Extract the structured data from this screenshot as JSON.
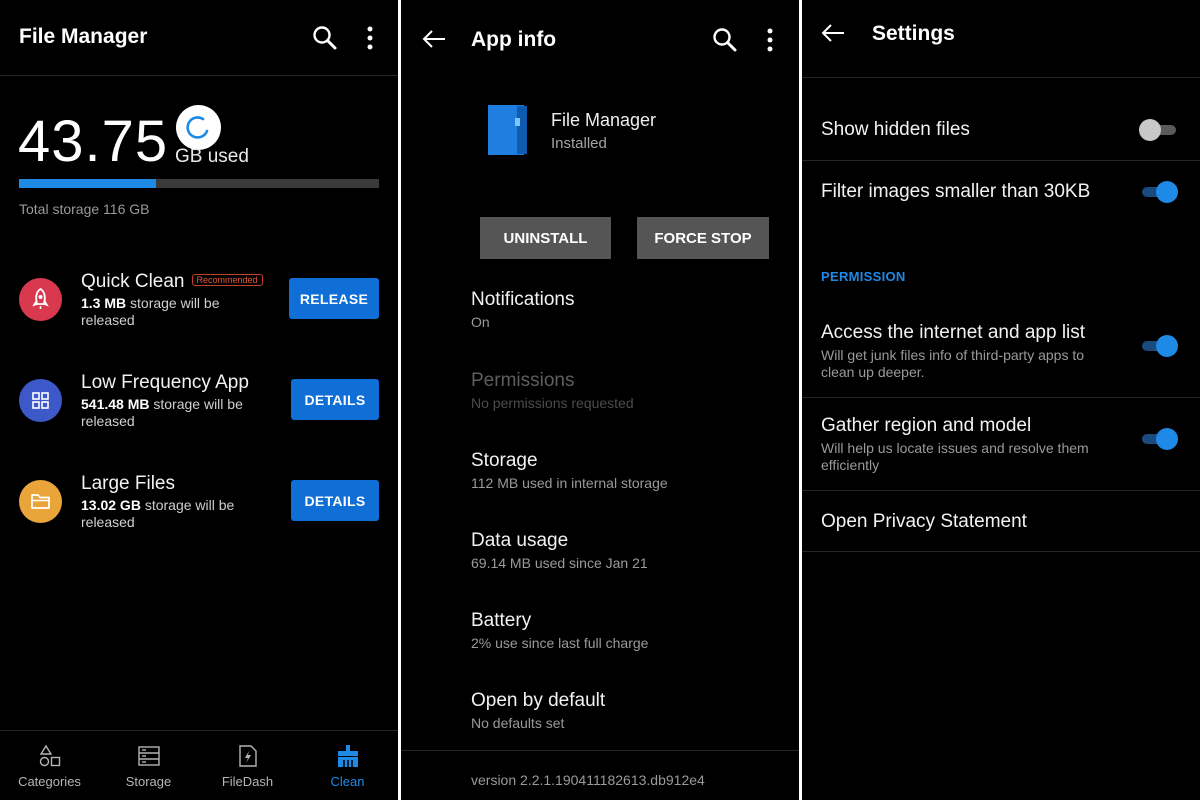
{
  "colors": {
    "accent": "#1f8ae6",
    "button_blue": "#0f6fd6",
    "button_gray": "#555555",
    "background": "#000000"
  },
  "file_manager": {
    "title": "File Manager",
    "storage_used_value": "43.75",
    "storage_used_unit": "GB used",
    "storage_used_fraction": 0.38,
    "total_storage": "Total storage 116 GB",
    "items": [
      {
        "title": "Quick Clean",
        "badge": "Recommended",
        "amount": "1.3 MB",
        "desc": " storage will be released",
        "button": "RELEASE",
        "icon": "rocket-icon",
        "color": "#d9394e"
      },
      {
        "title": "Low Frequency App",
        "amount": "541.48 MB",
        "desc": " storage will be released",
        "button": "DETAILS",
        "icon": "grid-icon",
        "color": "#3d58c9"
      },
      {
        "title": "Large Files",
        "amount": "13.02 GB",
        "desc": " storage will be released",
        "button": "DETAILS",
        "icon": "folder-icon",
        "color": "#e9a53a"
      }
    ],
    "nav": [
      {
        "label": "Categories",
        "icon": "categories-icon",
        "active": false
      },
      {
        "label": "Storage",
        "icon": "storage-icon",
        "active": false
      },
      {
        "label": "FileDash",
        "icon": "filedash-icon",
        "active": false
      },
      {
        "label": "Clean",
        "icon": "clean-icon",
        "active": true
      }
    ]
  },
  "app_info": {
    "title": "App info",
    "app_name": "File Manager",
    "app_status": "Installed",
    "uninstall_label": "UNINSTALL",
    "force_stop_label": "FORCE STOP",
    "items": [
      {
        "title": "Notifications",
        "sub": "On",
        "disabled": false
      },
      {
        "title": "Permissions",
        "sub": "No permissions requested",
        "disabled": true
      },
      {
        "title": "Storage",
        "sub": "112 MB used in internal storage",
        "disabled": false
      },
      {
        "title": "Data usage",
        "sub": "69.14 MB used since Jan 21",
        "disabled": false
      },
      {
        "title": "Battery",
        "sub": "2% use since last full charge",
        "disabled": false
      },
      {
        "title": "Open by default",
        "sub": "No defaults set",
        "disabled": false
      }
    ],
    "version": "version 2.2.1.190411182613.db912e4"
  },
  "settings": {
    "title": "Settings",
    "show_hidden": {
      "title": "Show hidden files",
      "on": false
    },
    "filter_images": {
      "title": "Filter images smaller than 30KB",
      "on": true
    },
    "permission_header": "PERMISSION",
    "internet": {
      "title": "Access the internet and app list",
      "sub": "Will get junk files info of third-party apps to clean up deeper.",
      "on": true
    },
    "region": {
      "title": "Gather region and model",
      "sub": "Will help us locate issues and resolve them efficiently",
      "on": true
    },
    "privacy": "Open Privacy Statement"
  }
}
